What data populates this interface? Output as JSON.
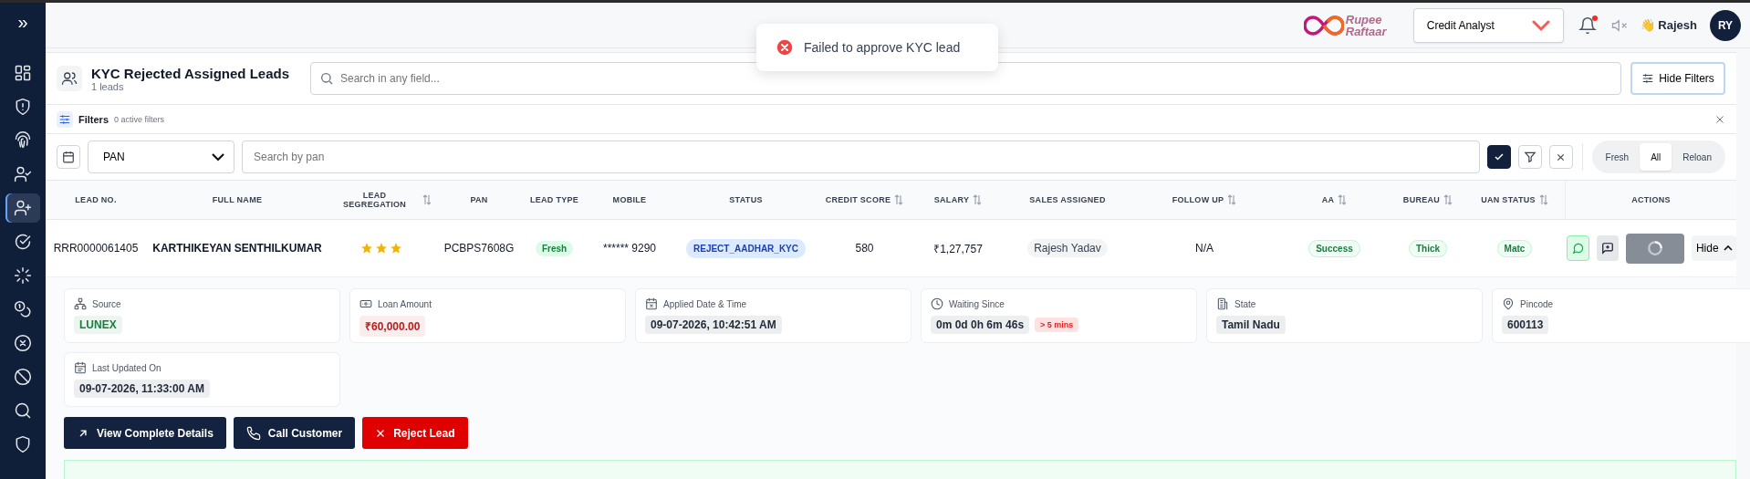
{
  "sidebar": {
    "toggle": "»",
    "items": [
      {
        "kind": "dashboard",
        "selected": false
      },
      {
        "kind": "shield-alert",
        "selected": false
      },
      {
        "kind": "fingerprint",
        "selected": false
      },
      {
        "kind": "user-check",
        "selected": false
      },
      {
        "kind": "user-plus",
        "selected": true
      },
      {
        "kind": "check-circle",
        "selected": false
      },
      {
        "kind": "loader",
        "selected": false
      },
      {
        "kind": "coins",
        "selected": false
      },
      {
        "kind": "x-circle",
        "selected": false
      },
      {
        "kind": "ban",
        "selected": false
      },
      {
        "kind": "search",
        "selected": false
      },
      {
        "kind": "shield",
        "selected": false
      }
    ]
  },
  "topbar": {
    "logo": "Rupee Raftaar",
    "role": "Credit Analyst",
    "notifications_unread": true,
    "user_name": "👋 Rajesh",
    "avatar": "RY"
  },
  "toast": {
    "message": "Failed to approve KYC lead"
  },
  "page": {
    "title": "KYC Rejected Assigned Leads",
    "count": "1 leads",
    "search": {
      "placeholder": "Search in any field..."
    },
    "hide_filters": "Hide Filters"
  },
  "filters": {
    "title": "Filters",
    "active": "0 active filters",
    "field": "PAN",
    "search": {
      "placeholder": "Search by pan"
    },
    "segments": [
      {
        "label": "Fresh",
        "selected": false
      },
      {
        "label": "All",
        "selected": true
      },
      {
        "label": "Reloan",
        "selected": false
      }
    ]
  },
  "table": {
    "columns": [
      {
        "label": "LEAD NO.",
        "sortable": false
      },
      {
        "label": "FULL NAME",
        "sortable": false
      },
      {
        "label": "LEAD SEGREGATION",
        "sortable": true
      },
      {
        "label": "PAN",
        "sortable": false
      },
      {
        "label": "LEAD TYPE",
        "sortable": false
      },
      {
        "label": "MOBILE",
        "sortable": false
      },
      {
        "label": "STATUS",
        "sortable": false
      },
      {
        "label": "CREDIT SCORE",
        "sortable": true
      },
      {
        "label": "SALARY",
        "sortable": true
      },
      {
        "label": "SALES ASSIGNED",
        "sortable": false
      },
      {
        "label": "FOLLOW UP",
        "sortable": true
      },
      {
        "label": "AA",
        "sortable": true
      },
      {
        "label": "BUREAU",
        "sortable": true
      },
      {
        "label": "UAN STATUS",
        "sortable": true
      },
      {
        "label": "ACTIONS",
        "sortable": false
      }
    ],
    "rows": [
      {
        "lead_no": "RRR0000061405",
        "full_name": "KARTHIKEYAN SENTHILKUMAR",
        "stars": 3,
        "pan": "PCBPS7608G",
        "lead_type": "Fresh",
        "mobile": "****** 9290",
        "status": "REJECT_AADHAR_KYC",
        "credit_score": "580",
        "salary": "₹1,27,757",
        "sales_assigned": "Rajesh Yadav",
        "follow_up": "N/A",
        "aa": "Success",
        "bureau": "Thick",
        "uan_status": "Matc",
        "hide": "Hide",
        "loading": true
      }
    ]
  },
  "details": [
    {
      "kind": "source",
      "label": "Source",
      "value": "LUNEX",
      "color": "#15803d"
    },
    {
      "kind": "money",
      "label": "Loan Amount",
      "value": "₹60,000.00",
      "color": "#b91c1c"
    },
    {
      "kind": "calendar-x",
      "label": "Applied Date & Time",
      "value": "09-07-2026, 10:42:51 AM",
      "color": "#1f2937"
    },
    {
      "kind": "clock",
      "label": "Waiting Since",
      "value": "0m 0d 0h 6m 46s",
      "color": "#1f2937",
      "flag": "> 5 mins"
    },
    {
      "kind": "building",
      "label": "State",
      "value": "Tamil Nadu",
      "color": "#1f2937"
    },
    {
      "kind": "pin",
      "label": "Pincode",
      "value": "600113",
      "color": "#1f2937"
    },
    {
      "kind": "calendar",
      "label": "Last Updated On",
      "value": "09-07-2026, 11:33:00 AM",
      "color": "#1f2937"
    }
  ],
  "actions": [
    {
      "kind": "view",
      "label": "View Complete Details"
    },
    {
      "kind": "call",
      "label": "Call Customer"
    },
    {
      "kind": "reject",
      "label": "Reject Lead"
    }
  ]
}
